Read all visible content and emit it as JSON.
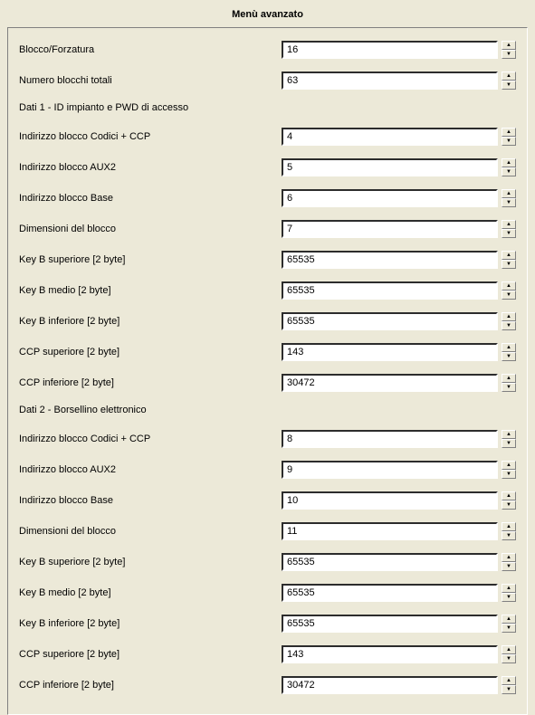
{
  "title": "Menù avanzato",
  "section1": {
    "header": "Dati 1 - ID impianto e PWD di accesso"
  },
  "section2": {
    "header": "Dati 2 - Borsellino elettronico"
  },
  "rows": {
    "r0": {
      "label": "Blocco/Forzatura",
      "value": "16"
    },
    "r1": {
      "label": "Numero blocchi totali",
      "value": "63"
    },
    "r2": {
      "label": "Indirizzo blocco Codici + CCP",
      "value": "4"
    },
    "r3": {
      "label": "Indirizzo blocco AUX2",
      "value": "5"
    },
    "r4": {
      "label": "Indirizzo blocco Base",
      "value": "6"
    },
    "r5": {
      "label": "Dimensioni del blocco",
      "value": "7"
    },
    "r6": {
      "label": "Key B superiore [2 byte]",
      "value": "65535"
    },
    "r7": {
      "label": "Key B medio [2 byte]",
      "value": "65535"
    },
    "r8": {
      "label": "Key B inferiore [2 byte]",
      "value": "65535"
    },
    "r9": {
      "label": "CCP superiore [2 byte]",
      "value": "143"
    },
    "r10": {
      "label": "CCP inferiore [2 byte]",
      "value": "30472"
    },
    "r11": {
      "label": "Indirizzo blocco Codici + CCP",
      "value": "8"
    },
    "r12": {
      "label": "Indirizzo blocco AUX2",
      "value": "9"
    },
    "r13": {
      "label": "Indirizzo blocco Base",
      "value": "10"
    },
    "r14": {
      "label": "Dimensioni del blocco",
      "value": "11"
    },
    "r15": {
      "label": "Key B superiore [2 byte]",
      "value": "65535"
    },
    "r16": {
      "label": "Key B medio [2 byte]",
      "value": "65535"
    },
    "r17": {
      "label": "Key B inferiore [2 byte]",
      "value": "65535"
    },
    "r18": {
      "label": "CCP superiore [2 byte]",
      "value": "143"
    },
    "r19": {
      "label": "CCP inferiore [2 byte]",
      "value": "30472"
    }
  }
}
